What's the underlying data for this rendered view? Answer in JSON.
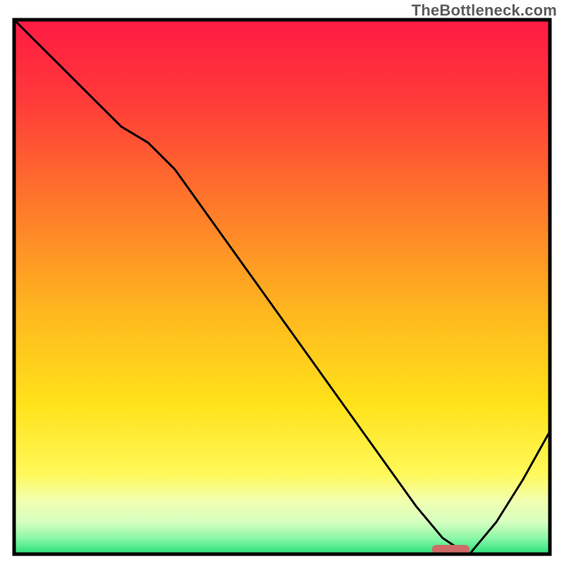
{
  "watermark": "TheBottleneck.com",
  "chart_data": {
    "type": "line",
    "title": "",
    "xlabel": "",
    "ylabel": "",
    "xlim": [
      0,
      100
    ],
    "ylim": [
      0,
      100
    ],
    "gradient_stops": [
      {
        "offset": 0.0,
        "color": "#ff1a44"
      },
      {
        "offset": 0.15,
        "color": "#ff3a3a"
      },
      {
        "offset": 0.35,
        "color": "#ff7a2a"
      },
      {
        "offset": 0.55,
        "color": "#ffb81f"
      },
      {
        "offset": 0.72,
        "color": "#ffe21a"
      },
      {
        "offset": 0.85,
        "color": "#fff95a"
      },
      {
        "offset": 0.9,
        "color": "#f2ffb0"
      },
      {
        "offset": 0.94,
        "color": "#d6ffbf"
      },
      {
        "offset": 0.97,
        "color": "#8cf7a8"
      },
      {
        "offset": 1.0,
        "color": "#28e07a"
      }
    ],
    "series": [
      {
        "name": "bottleneck-curve",
        "x": [
          0,
          5,
          10,
          15,
          20,
          25,
          30,
          35,
          40,
          45,
          50,
          55,
          60,
          65,
          70,
          75,
          80,
          83,
          85,
          90,
          95,
          100
        ],
        "y": [
          100,
          95,
          90,
          85,
          80,
          77,
          72,
          65,
          58,
          51,
          44,
          37,
          30,
          23,
          16,
          9,
          3,
          1,
          0,
          6,
          14,
          23
        ]
      }
    ],
    "marker": {
      "name": "optimal-range",
      "x_start": 78,
      "x_end": 85,
      "y": 0,
      "color": "#cf6a67"
    },
    "border_color": "#000000",
    "line_color": "#000000"
  }
}
